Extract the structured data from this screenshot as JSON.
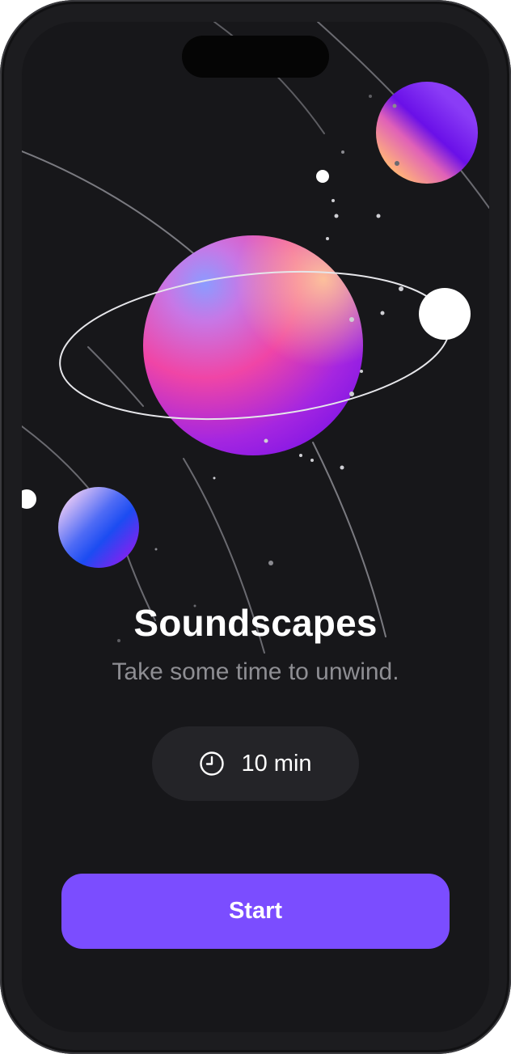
{
  "screen": {
    "title": "Soundscapes",
    "subtitle": "Take some time to unwind.",
    "duration": {
      "label": "10 min",
      "icon": "clock-icon"
    },
    "start_button": {
      "label": "Start"
    },
    "illustration": {
      "name": "planets-illustration"
    }
  },
  "colors": {
    "background": "#17171a",
    "device_frame": "#1c1c1f",
    "pill_background": "#242428",
    "accent": "#7b4dff",
    "subtitle_text": "#8e8e93",
    "title_text": "#ffffff"
  }
}
